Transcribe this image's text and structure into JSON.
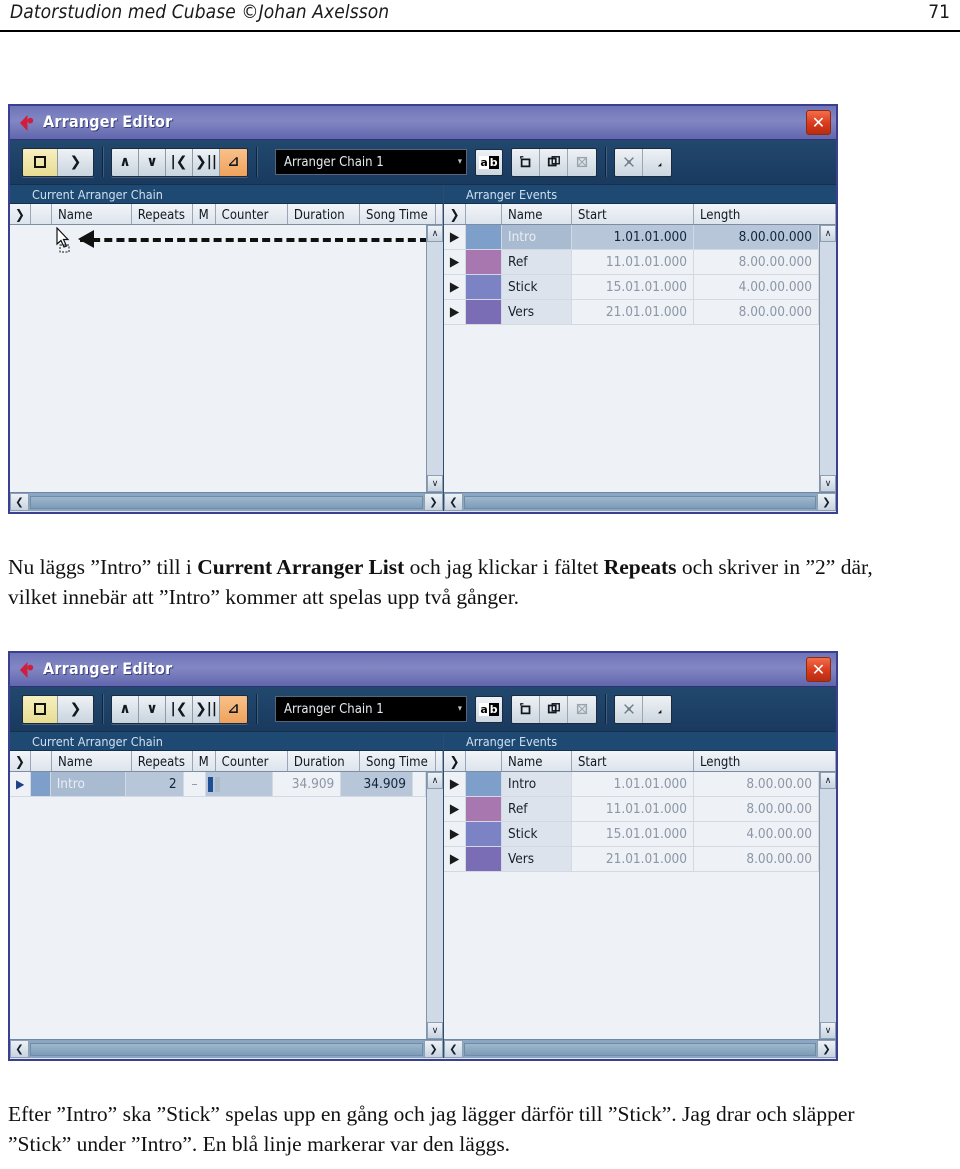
{
  "page": {
    "header_title": "Datorstudion med Cubase ©Johan Axelsson",
    "page_number": "71"
  },
  "paragraphs": {
    "first": {
      "a": "Nu läggs ”Intro” till i ",
      "b1": "Current Arranger List",
      "c": " och jag klickar i fältet ",
      "b2": "Repeats",
      "d": " och skriver in ”2” där, vilket innebär att ”Intro” kommer att spelas upp två gånger."
    },
    "second": {
      "text": "Efter ”Intro” ska ”Stick” spelas upp en gång och jag lägger därför till ”Stick”. Jag drar och släpper ”Stick” under ”Intro”. En blå linje markerar var den läggs."
    }
  },
  "window": {
    "title": "Arranger Editor",
    "close_label": "✕",
    "logo_icon": "cubase-logo-icon",
    "toolbar": {
      "stop_icon": "stop-icon",
      "play_label": "❯",
      "prev_chevron": "∧",
      "next_chevron": "∨",
      "first_label": "|❮",
      "next_label": "❯||",
      "arranger_mode_label": "⊿",
      "combo_value": "Arranger Chain 1",
      "combo_arrow": "▾",
      "rename_a": "a",
      "rename_b": "b",
      "new_icon": "new-chain-icon",
      "copy_icon": "copy-chain-icon",
      "delete_icon": "delete-chain-icon",
      "flatten_icon": "flatten-chain-icon"
    },
    "left_pane": {
      "title": "Current Arranger Chain",
      "columns": [
        "❯",
        "",
        "Name",
        "Repeats",
        "M",
        "Counter",
        "Duration",
        "Song Time",
        ""
      ]
    },
    "right_pane": {
      "title": "Arranger Events",
      "columns": [
        "❯",
        "",
        "Name",
        "Start",
        "Length"
      ]
    },
    "scroll": {
      "up": "∧",
      "down": "∨",
      "left": "❮",
      "right": "❯"
    }
  },
  "colors": {
    "intro": "#7e9fc9",
    "ref": "#a977b0",
    "stick": "#7b83c4",
    "vers": "#7b6cb6",
    "accent_orange": "#efa25c",
    "titlebar": "#7277bd",
    "toolbar": "#1d4067",
    "pane_header": "#1d4973",
    "close_red": "#d93a1c"
  },
  "screen1": {
    "chain_rows": [],
    "events_rows": [
      {
        "name": "Intro",
        "start": "1.01.01.000",
        "length": "8.00.00.000",
        "color": "#7e9fc9",
        "selected": true
      },
      {
        "name": "Ref",
        "start": "11.01.01.000",
        "length": "8.00.00.000",
        "color": "#a977b0",
        "selected": false
      },
      {
        "name": "Stick",
        "start": "15.01.01.000",
        "length": "4.00.00.000",
        "color": "#7b83c4",
        "selected": false
      },
      {
        "name": "Vers",
        "start": "21.01.01.000",
        "length": "8.00.00.000",
        "color": "#7b6cb6",
        "selected": false
      }
    ],
    "drag_annotation": "drag-intro-to-chain"
  },
  "screen2": {
    "chain_rows": [
      {
        "name": "Intro",
        "repeats": "2",
        "m": "–",
        "counter": "counter-bar",
        "duration": "34.909",
        "song_time": "34.909",
        "color": "#7e9fc9"
      }
    ],
    "events_rows": [
      {
        "name": "Intro",
        "start": "1.01.01.000",
        "length": "8.00.00.00",
        "color": "#7e9fc9",
        "selected": false
      },
      {
        "name": "Ref",
        "start": "11.01.01.000",
        "length": "8.00.00.00",
        "color": "#a977b0",
        "selected": false
      },
      {
        "name": "Stick",
        "start": "15.01.01.000",
        "length": "4.00.00.00",
        "color": "#7b83c4",
        "selected": false
      },
      {
        "name": "Vers",
        "start": "21.01.01.000",
        "length": "8.00.00.00",
        "color": "#7b6cb6",
        "selected": false
      }
    ]
  }
}
